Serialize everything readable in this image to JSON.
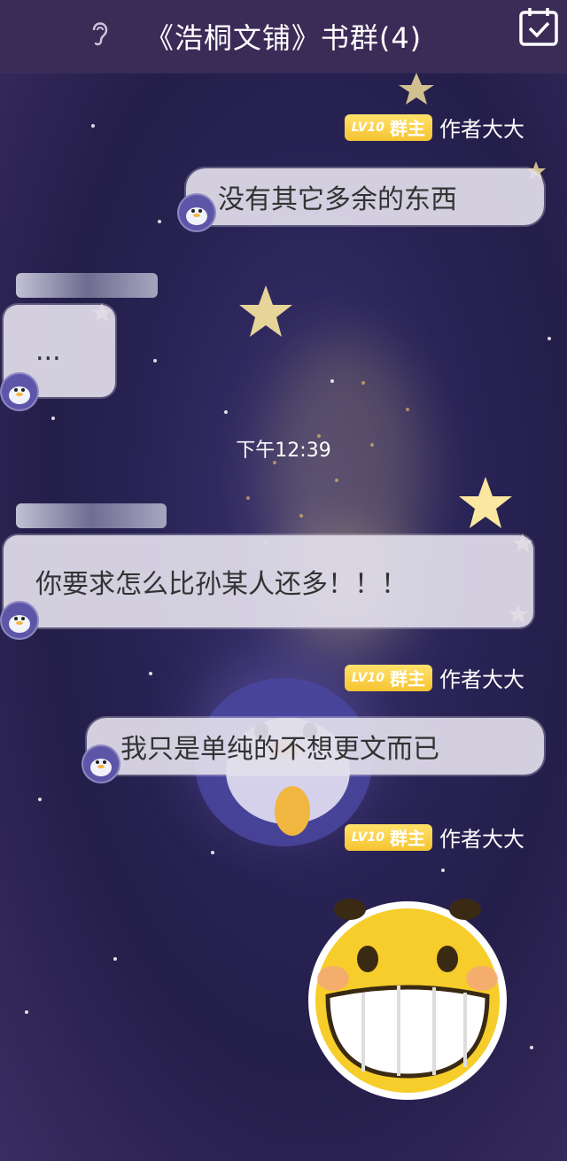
{
  "header": {
    "title": "《浩桐文铺》书群(4)"
  },
  "messages": [
    {
      "badge_level": "LV10",
      "badge_role": "群主",
      "author": "作者大大",
      "text": "没有其它多余的东西"
    },
    {
      "text": "..."
    },
    {
      "time": "下午12:39"
    },
    {
      "text": "你要求怎么比孙某人还多！！！"
    },
    {
      "badge_level": "LV10",
      "badge_role": "群主",
      "author": "作者大大",
      "text": "我只是单纯的不想更文而已"
    },
    {
      "badge_level": "LV10",
      "badge_role": "群主",
      "author": "作者大大",
      "sticker": "grinning-face-sticker"
    }
  ],
  "colors": {
    "header_bg": "#3a2b57",
    "badge_yellow": "#f5c431",
    "bubble_bg": "#e2deec"
  },
  "icons": {
    "header_left": "ear-icon",
    "header_right": "calendar-check-icon"
  }
}
